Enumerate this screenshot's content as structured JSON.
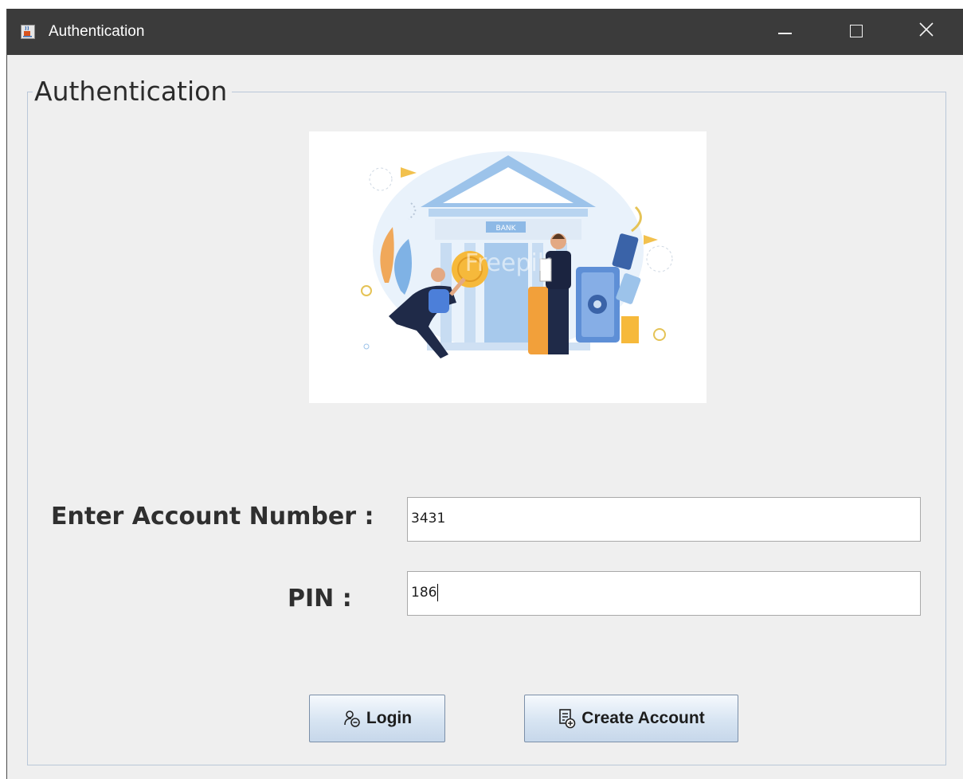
{
  "window": {
    "title": "Authentication",
    "icon": "java-cup-icon",
    "controls": [
      "minimize-icon",
      "maximize-icon",
      "close-icon"
    ]
  },
  "panel": {
    "legend": "Authentication"
  },
  "illustration": {
    "sign_text": "BANK",
    "watermark_text": "Freepik"
  },
  "form": {
    "account_label": "Enter Account Number :",
    "account_value": "3431",
    "pin_label": "PIN :",
    "pin_value": "186"
  },
  "buttons": {
    "login_label": "Login",
    "login_icon": "user-login-icon",
    "create_label": "Create Account",
    "create_icon": "add-document-icon"
  },
  "colors": {
    "titlebar": "#3b3b3b",
    "background": "#efefef",
    "button_gradient_top": "#f5f9fd",
    "button_gradient_bottom": "#c6d7ea"
  }
}
